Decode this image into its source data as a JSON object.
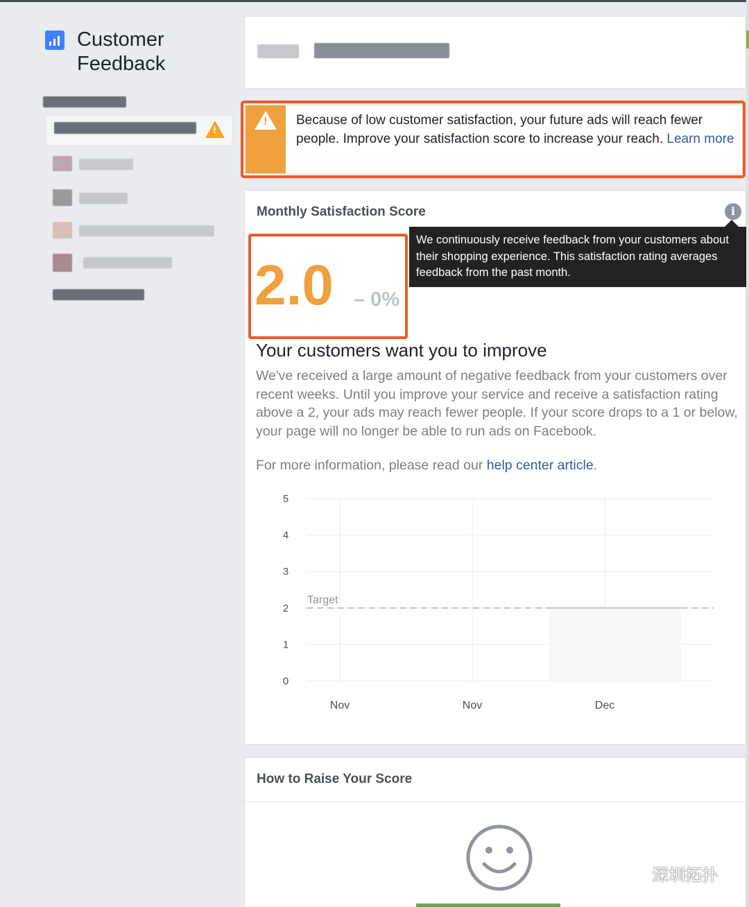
{
  "app": {
    "title": "Customer Feedback",
    "icon": "bar-chart-icon"
  },
  "alert": {
    "text": "Because of low customer satisfaction, your future ads will reach fewer people. Improve your satisfaction score to increase your reach.",
    "link": "Learn more",
    "icon": "warning-icon"
  },
  "score_panel": {
    "title": "Monthly Satisfaction Score",
    "info_icon": "info-icon",
    "tooltip": "We continuously receive feedback from your customers about their shopping experience. This satisfaction rating averages feedback from the past month.",
    "score": "2.0",
    "change": "– 0%",
    "heading": "Your customers want you to improve",
    "body": "We've received a large amount of negative feedback from your customers over recent weeks. Until you improve your service and receive a satisfaction rating above a 2, your ads may reach fewer people. If your score drops to a 1 or below, your page will no longer be able to run ads on Facebook.",
    "more_prefix": "For more information, please read our ",
    "more_link": "help center article",
    "more_suffix": "."
  },
  "chart_data": {
    "type": "line",
    "categories": [
      "Nov",
      "Nov",
      "Dec"
    ],
    "y_ticks": [
      "0",
      "1",
      "2",
      "3",
      "4",
      "5"
    ],
    "ylim": [
      0,
      5
    ],
    "target": {
      "label": "Target",
      "value": 2
    },
    "series": [
      {
        "values": [
          null,
          null,
          2
        ]
      }
    ],
    "grid": true
  },
  "raise_panel": {
    "title": "How to Raise Your Score",
    "icon": "smiley-icon"
  },
  "watermark": {
    "text": "深圳拓扑",
    "icon": "wechat-icon"
  },
  "colors": {
    "accent": "#f0a03c",
    "highlight": "#ec5a2d",
    "link": "#365899"
  }
}
